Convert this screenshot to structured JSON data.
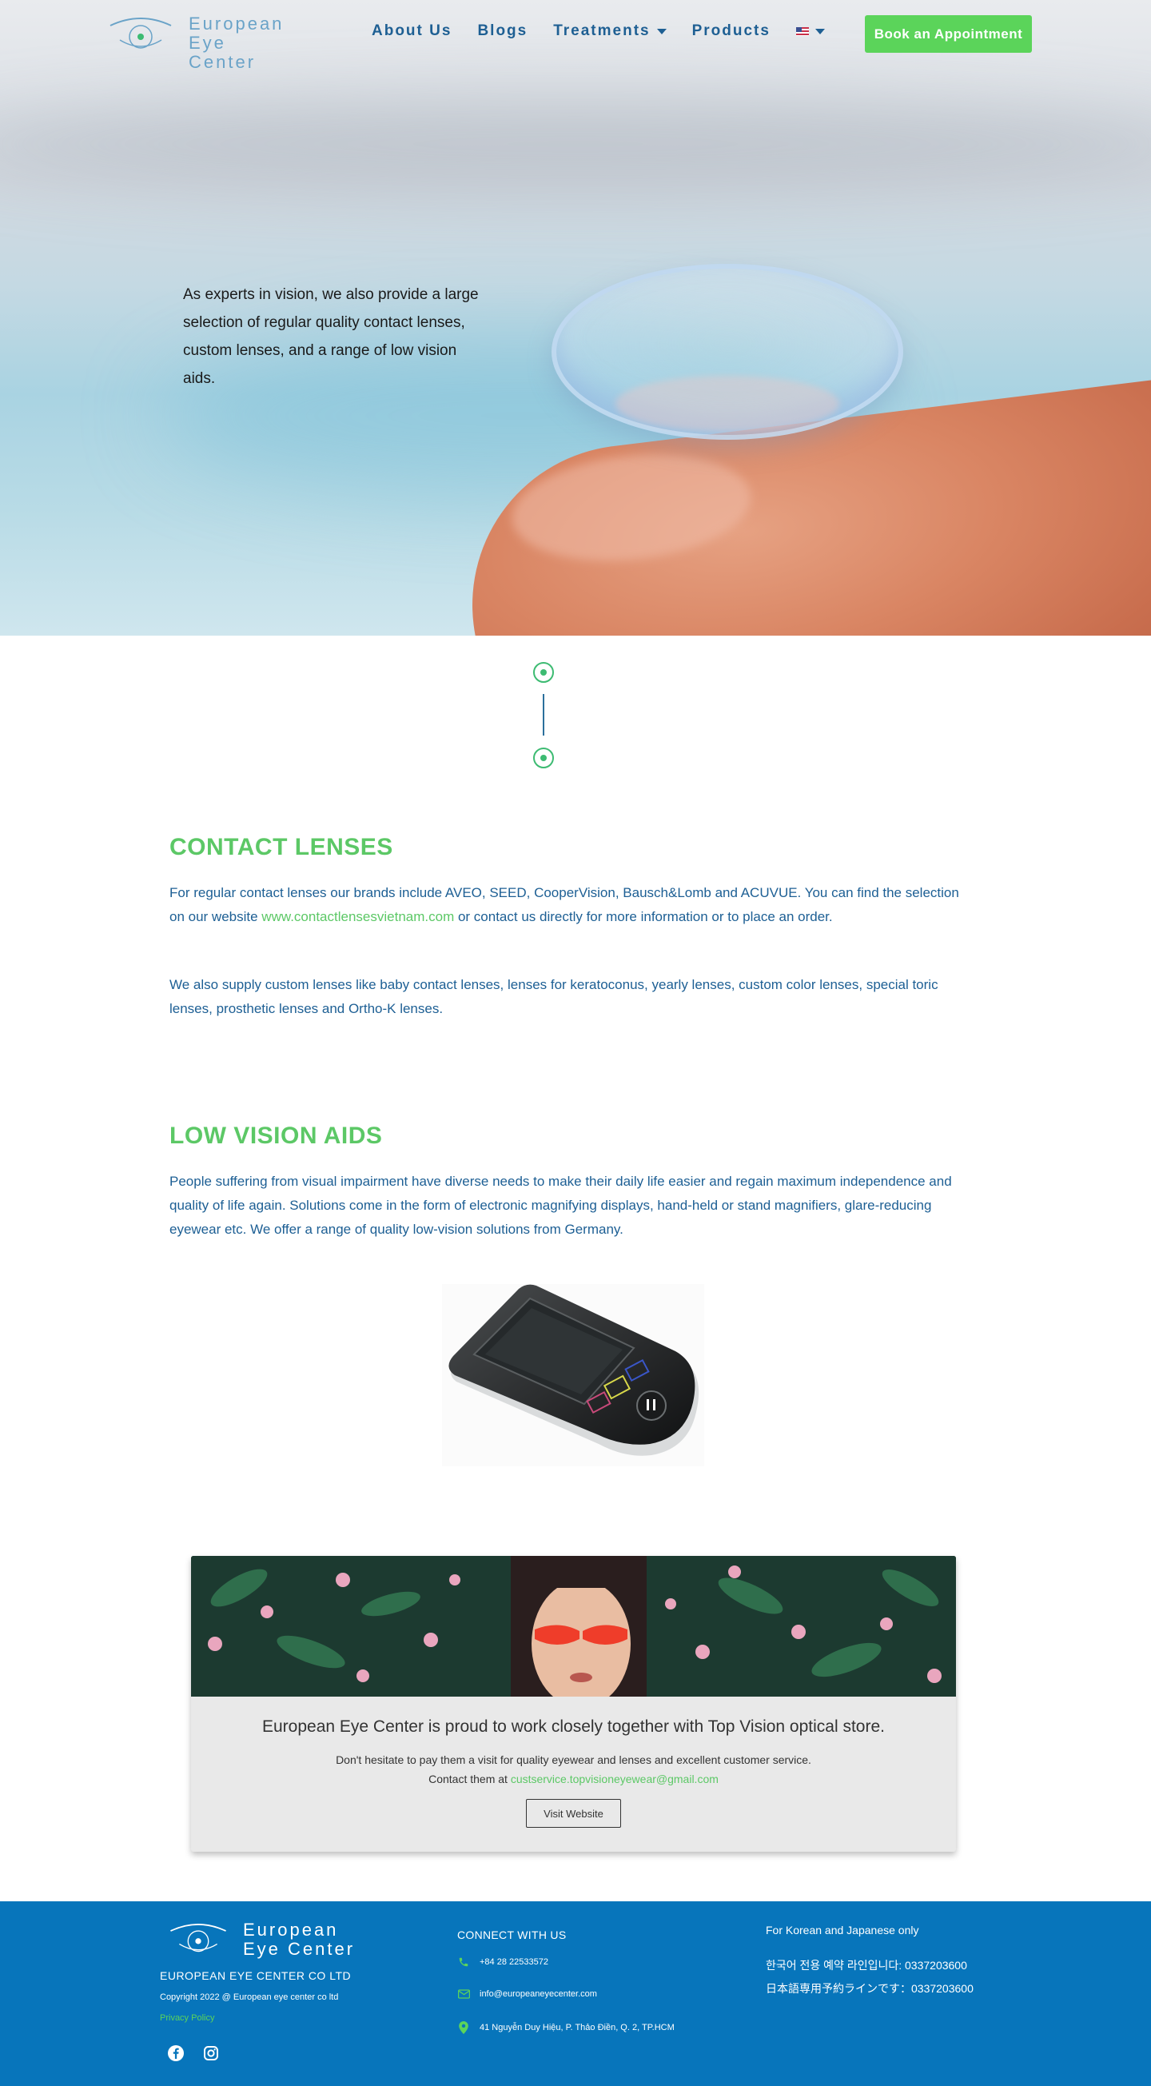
{
  "header": {
    "logo_line1": "European",
    "logo_line2": "Eye Center",
    "nav": [
      "About Us",
      "Blogs",
      "Treatments",
      "Products"
    ],
    "book_label": "Book an Appointment"
  },
  "hero": {
    "text": "As experts in vision, we also provide a large selection of regular quality contact lenses, custom lenses, and a range of low vision aids."
  },
  "contact_lenses": {
    "title": "CONTACT LENSES",
    "p1_before": "For regular contact lenses our brands include AVEO, SEED, CooperVision, Bausch&Lomb and ACUVUE. You can find the selection on our website ",
    "p1_link": "www.contactlensesvietnam.com",
    "p1_after": " or contact us directly for more information or to place an order.",
    "p2": "We also supply custom lenses like baby contact lenses, lenses for keratoconus, yearly lenses, custom color lenses, special toric lenses, prosthetic lenses and Ortho-K lenses."
  },
  "low_vision": {
    "title": "LOW VISION AIDS",
    "p1": "People suffering from visual impairment have diverse needs to make their daily life easier and regain maximum independence and quality of life again. Solutions come in the form of electronic magnifying displays, hand-held or stand magnifiers, glare-reducing eyewear etc. We offer a range of quality low-vision solutions from Germany."
  },
  "partner": {
    "title": "European Eye Center is proud to work closely together with Top Vision optical store.",
    "line1": "Don't hesitate to pay them a visit for quality eyewear and lenses and excellent customer service.",
    "line2_before": "Contact them at ",
    "line2_link": "custservice.topvisioneyewear@gmail.com",
    "button": "Visit Website"
  },
  "footer": {
    "logo_line1": "European",
    "logo_line2": "Eye Center",
    "company": "EUROPEAN EYE CENTER CO LTD",
    "copyright": "Copyright 2022 @ European eye center co ltd",
    "privacy": "Privacy Policy",
    "connect_title": "CONNECT WITH US",
    "phone": "+84 28 22533572",
    "email": "info@europeaneyecenter.com",
    "address": "41 Nguyễn Duy Hiệu, P. Thảo Điền, Q. 2, TP.HCM",
    "kj_title": "For Korean and Japanese only",
    "korean_line": "한국어 전용 예약 라인입니다: 0337203600",
    "japanese_line": "日本語専用予約ラインです：0337203600"
  },
  "colors": {
    "green": "#5cc866",
    "navy": "#1d5f94",
    "footer_blue": "#0775bb",
    "button_green": "#5bd45a"
  }
}
